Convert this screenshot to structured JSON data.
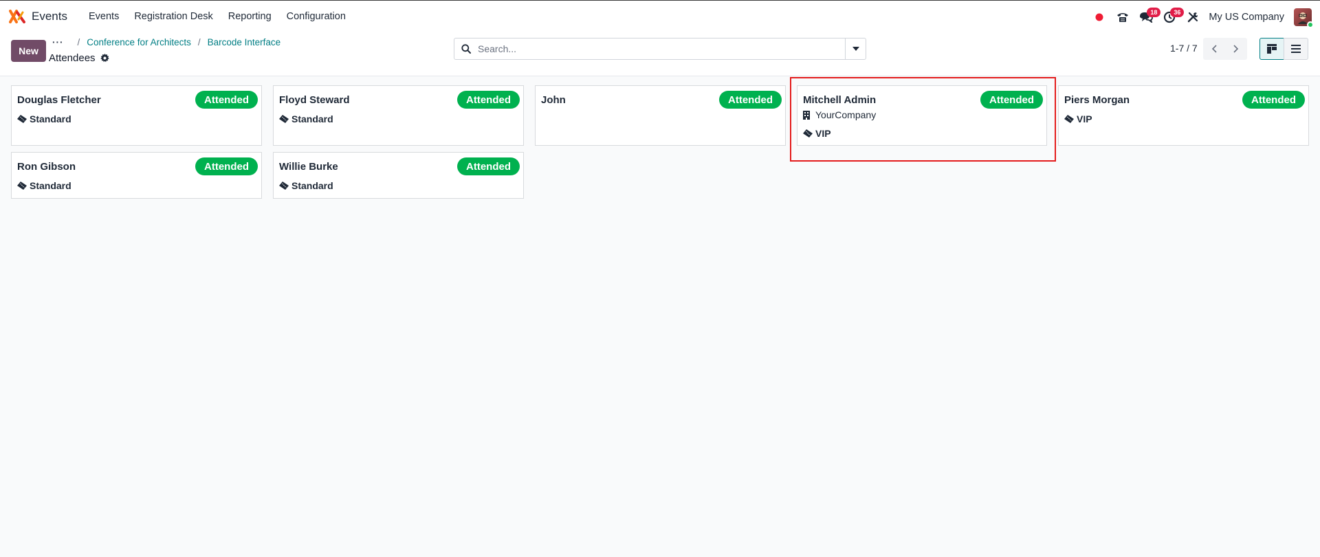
{
  "app": {
    "name": "Events",
    "logo_icon": "odoo-x-logo-icon",
    "menu": [
      "Events",
      "Registration Desk",
      "Reporting",
      "Configuration"
    ]
  },
  "systray": {
    "recording_indicator": "red-dot-icon",
    "phone_icon": "phone-icon",
    "messages_count": "18",
    "activities_count": "36",
    "tools_icon": "tools-icon",
    "company": "My US Company"
  },
  "control_panel": {
    "new_label": "New",
    "breadcrumb_dots": "···",
    "breadcrumbs": [
      "Conference for Architects",
      "Barcode Interface"
    ],
    "page_title": "Attendees",
    "search_placeholder": "Search...",
    "pager": "1-7 / 7"
  },
  "cards": [
    {
      "name": "Douglas Fletcher",
      "status": "Attended",
      "company": "",
      "ticket": "Standard"
    },
    {
      "name": "Floyd Steward",
      "status": "Attended",
      "company": "",
      "ticket": "Standard"
    },
    {
      "name": "John",
      "status": "Attended",
      "company": "",
      "ticket": ""
    },
    {
      "name": "Mitchell Admin",
      "status": "Attended",
      "company": "YourCompany",
      "ticket": "VIP"
    },
    {
      "name": "Piers Morgan",
      "status": "Attended",
      "company": "",
      "ticket": "VIP"
    },
    {
      "name": "Ron Gibson",
      "status": "Attended",
      "company": "",
      "ticket": "Standard"
    },
    {
      "name": "Willie Burke",
      "status": "Attended",
      "company": "",
      "ticket": "Standard"
    }
  ],
  "colors": {
    "brand": "#714b67",
    "link": "#017e84",
    "attended": "#00b14f",
    "badge": "#e11d48",
    "highlight": "#e41b1b"
  }
}
